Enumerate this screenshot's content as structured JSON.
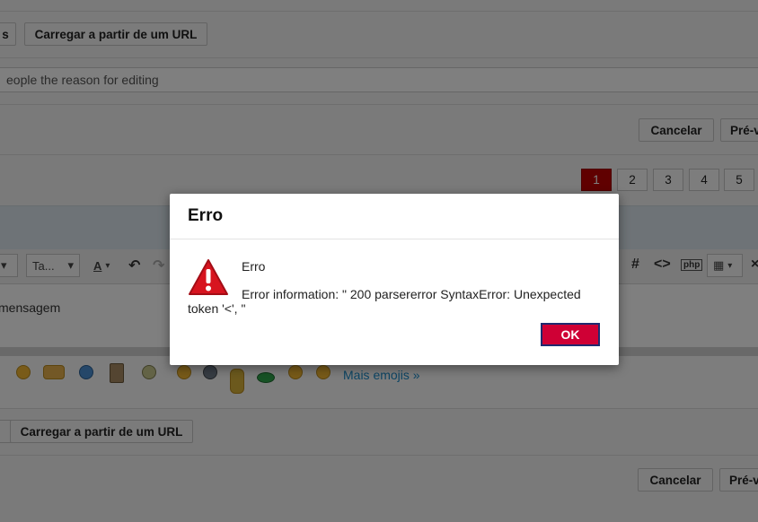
{
  "top_section": {
    "partial_button_label": "s",
    "load_url_label": "Carregar a partir de um URL",
    "reason_input_text": "eople the reason for editing"
  },
  "actions_top": {
    "cancel_label": "Cancelar",
    "preview_label": "Pré-v"
  },
  "pagination": {
    "pages": [
      "1",
      "2",
      "3",
      "4",
      "5"
    ],
    "active_page": 1
  },
  "toolbar": {
    "size_select_label": "Ta...",
    "text_color_label": "A"
  },
  "editor": {
    "text": "mensagem"
  },
  "emojis": {
    "more_link": "Mais emojis »"
  },
  "bottom_section": {
    "load_url_label": "Carregar a partir de um URL",
    "cancel_label": "Cancelar",
    "preview_label": "Pré-v"
  },
  "dialog": {
    "title": "Erro",
    "message_heading": "Erro",
    "message_body": "Error information: \" 200 parsererror SyntaxError: Unexpected token '<', \"",
    "ok_label": "OK"
  },
  "colors": {
    "accent_red": "#cf0035",
    "link_blue": "#1a8bc9",
    "active_page": "#c00000"
  }
}
